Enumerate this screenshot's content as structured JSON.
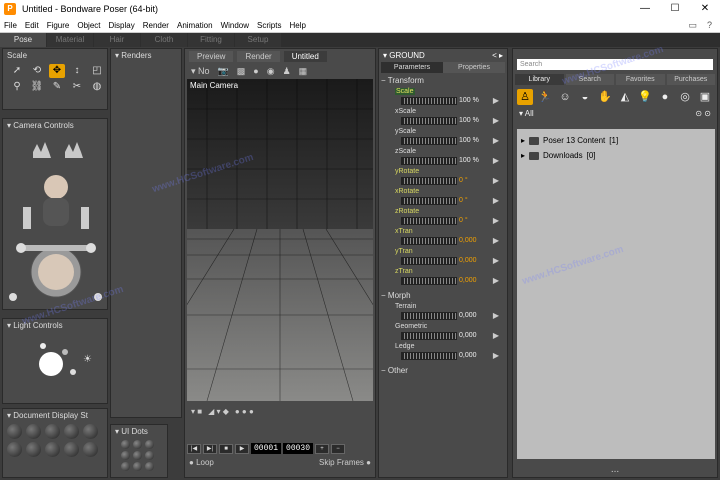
{
  "window": {
    "title": "Untitled - Bondware Poser (64-bit)",
    "minimize": "—",
    "maximize": "☐",
    "close": "✕"
  },
  "menu": [
    "File",
    "Edit",
    "Figure",
    "Object",
    "Display",
    "Render",
    "Animation",
    "Window",
    "Scripts",
    "Help"
  ],
  "menu_right_icons": [
    "chat-icon",
    "help-icon"
  ],
  "rooms": [
    "Pose",
    "Material",
    "Hair",
    "Cloth",
    "Fitting",
    "Setup"
  ],
  "active_room": "Pose",
  "tools": {
    "title": "Scale"
  },
  "camera_controls": {
    "title": "Camera Controls"
  },
  "light_controls": {
    "title": "Light Controls"
  },
  "document_display": {
    "title": "Document Display St"
  },
  "renders": {
    "title": "Renders"
  },
  "ui_dots": {
    "title": "UI Dots"
  },
  "document": {
    "tabs": [
      "Preview",
      "Render",
      "Untitled"
    ],
    "active_tab": "Untitled",
    "toolbar_label": "No",
    "camera_label": "Main Camera"
  },
  "animation": {
    "current_frame": "00001",
    "total_frames": "00030",
    "loop_label": "Loop",
    "skip_frames_label": "Skip Frames"
  },
  "parameters": {
    "object": "GROUND",
    "tabs": [
      "Parameters",
      "Properties"
    ],
    "active_tab": "Parameters",
    "groups": [
      {
        "name": "Transform",
        "params": [
          {
            "name": "Scale",
            "value": "100 %",
            "style": "sel"
          },
          {
            "name": "xScale",
            "value": "100 %",
            "style": "norm"
          },
          {
            "name": "yScale",
            "value": "100 %",
            "style": "norm"
          },
          {
            "name": "zScale",
            "value": "100 %",
            "style": "norm"
          },
          {
            "name": "yRotate",
            "value": "0 °",
            "style": "hl"
          },
          {
            "name": "xRotate",
            "value": "0 °",
            "style": "hl"
          },
          {
            "name": "zRotate",
            "value": "0 °",
            "style": "hl"
          },
          {
            "name": "xTran",
            "value": "0,000",
            "style": "hl"
          },
          {
            "name": "yTran",
            "value": "0,000",
            "style": "hl"
          },
          {
            "name": "zTran",
            "value": "0,000",
            "style": "hl"
          }
        ]
      },
      {
        "name": "Morph",
        "params": [
          {
            "name": "Terrain",
            "value": "0,000",
            "style": "norm"
          },
          {
            "name": "Geometric",
            "value": "0,000",
            "style": "norm"
          },
          {
            "name": "Ledge",
            "value": "0,000",
            "style": "norm"
          }
        ]
      },
      {
        "name": "Other",
        "params": []
      }
    ]
  },
  "library": {
    "search_placeholder": "Search",
    "tabs": [
      "Library",
      "Search",
      "Favorites",
      "Purchases"
    ],
    "active_tab": "Library",
    "filter": "All",
    "items": [
      {
        "name": "Poser 13 Content",
        "count": "[1]"
      },
      {
        "name": "Downloads",
        "count": "[0]"
      }
    ],
    "footer": "..."
  },
  "watermark": "www.HCSoftware.com"
}
